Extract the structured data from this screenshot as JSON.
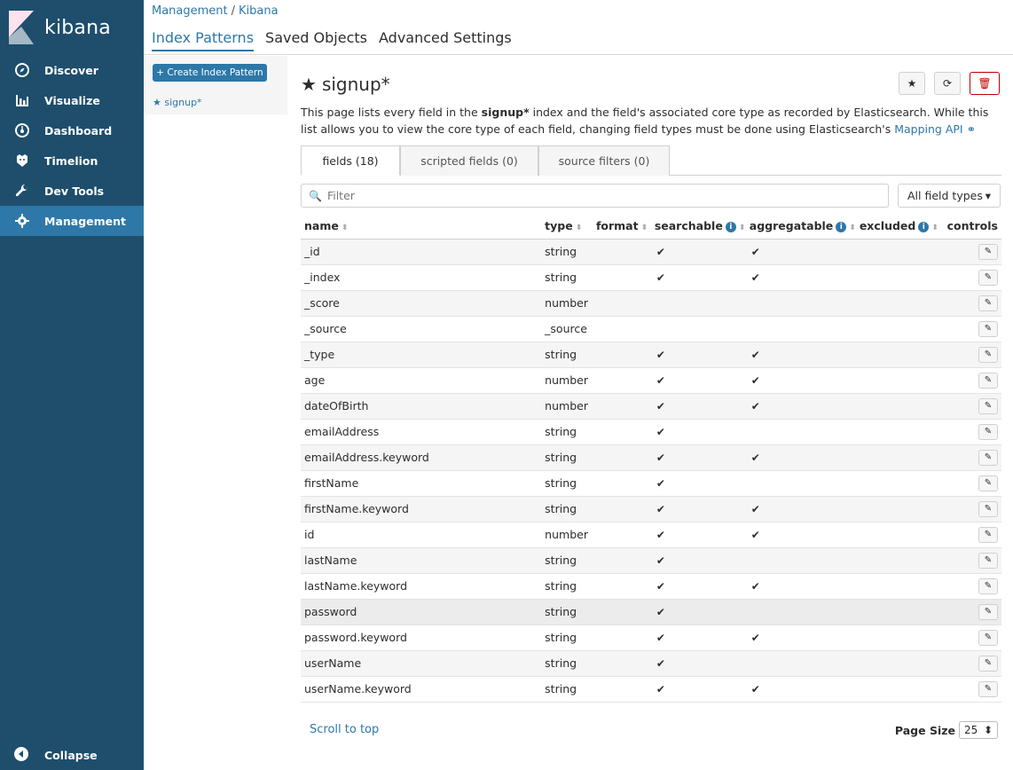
{
  "brand": {
    "name": "kibana"
  },
  "sidebar": {
    "items": [
      {
        "label": "Discover",
        "icon": "compass-icon"
      },
      {
        "label": "Visualize",
        "icon": "bar-chart-icon"
      },
      {
        "label": "Dashboard",
        "icon": "dashboard-icon"
      },
      {
        "label": "Timelion",
        "icon": "timelion-icon"
      },
      {
        "label": "Dev Tools",
        "icon": "wrench-icon"
      },
      {
        "label": "Management",
        "icon": "gear-icon",
        "active": true
      }
    ],
    "collapse_label": "Collapse"
  },
  "header": {
    "breadcrumb": [
      "Management",
      "Kibana"
    ],
    "breadcrumb_sep": "/",
    "tabs": [
      "Index Patterns",
      "Saved Objects",
      "Advanced Settings"
    ]
  },
  "left": {
    "create_label": "+ Create Index Pattern",
    "patterns": [
      "★ signup*"
    ]
  },
  "main": {
    "title": "signup*",
    "desc_before": "This page lists every field in the ",
    "desc_bold": "signup*",
    "desc_after": " index and the field's associated core type as recorded by Elasticsearch. While this list allows you to view the core type of each field, changing field types must be done using Elasticsearch's ",
    "desc_link": "Mapping API",
    "subtabs": [
      "fields (18)",
      "scripted fields (0)",
      "source filters (0)"
    ],
    "filter_placeholder": "Filter",
    "field_type_select": "All field types",
    "columns": [
      "name",
      "type",
      "format",
      "searchable",
      "aggregatable",
      "excluded",
      "controls"
    ],
    "rows": [
      {
        "name": "_id",
        "type": "string",
        "searchable": "✔",
        "aggregatable": "✔"
      },
      {
        "name": "_index",
        "type": "string",
        "searchable": "✔",
        "aggregatable": "✔"
      },
      {
        "name": "_score",
        "type": "number",
        "searchable": "",
        "aggregatable": ""
      },
      {
        "name": "_source",
        "type": "_source",
        "searchable": "",
        "aggregatable": ""
      },
      {
        "name": "_type",
        "type": "string",
        "searchable": "✔",
        "aggregatable": "✔"
      },
      {
        "name": "age",
        "type": "number",
        "searchable": "✔",
        "aggregatable": "✔"
      },
      {
        "name": "dateOfBirth",
        "type": "number",
        "searchable": "✔",
        "aggregatable": "✔"
      },
      {
        "name": "emailAddress",
        "type": "string",
        "searchable": "✔",
        "aggregatable": ""
      },
      {
        "name": "emailAddress.keyword",
        "type": "string",
        "searchable": "✔",
        "aggregatable": "✔"
      },
      {
        "name": "firstName",
        "type": "string",
        "searchable": "✔",
        "aggregatable": ""
      },
      {
        "name": "firstName.keyword",
        "type": "string",
        "searchable": "✔",
        "aggregatable": "✔"
      },
      {
        "name": "id",
        "type": "number",
        "searchable": "✔",
        "aggregatable": "✔"
      },
      {
        "name": "lastName",
        "type": "string",
        "searchable": "✔",
        "aggregatable": ""
      },
      {
        "name": "lastName.keyword",
        "type": "string",
        "searchable": "✔",
        "aggregatable": "✔"
      },
      {
        "name": "password",
        "type": "string",
        "searchable": "✔",
        "aggregatable": "",
        "highlight": true
      },
      {
        "name": "password.keyword",
        "type": "string",
        "searchable": "✔",
        "aggregatable": "✔"
      },
      {
        "name": "userName",
        "type": "string",
        "searchable": "✔",
        "aggregatable": ""
      },
      {
        "name": "userName.keyword",
        "type": "string",
        "searchable": "✔",
        "aggregatable": "✔"
      }
    ],
    "scroll_top_label": "Scroll to top",
    "page_size_label": "Page Size",
    "page_size_value": "25"
  }
}
